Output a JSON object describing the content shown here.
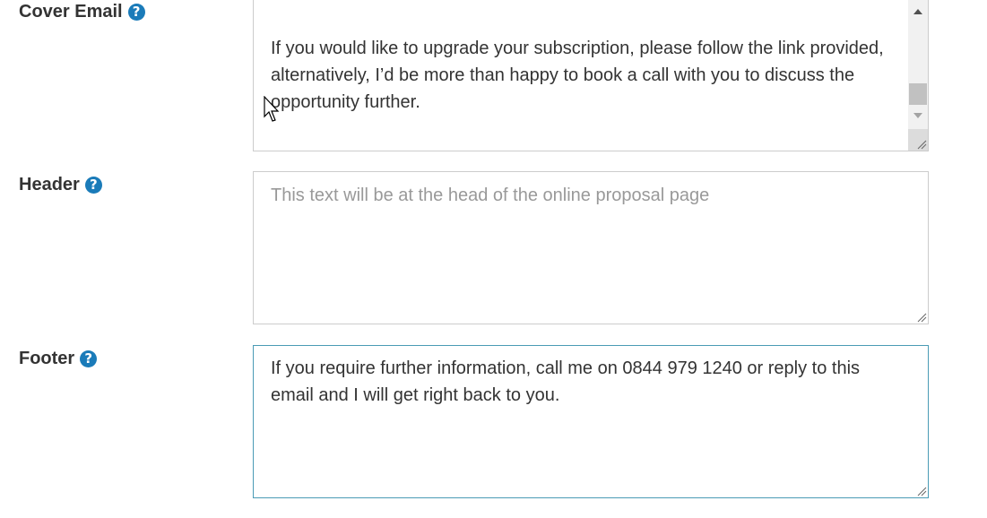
{
  "fields": {
    "cover_email": {
      "label": "Cover Email",
      "help_icon": "?",
      "paragraphs": [
        "If you would like to upgrade your subscription, please follow the link provided, alternatively, I’d be more than happy to book a call with you to discuss the opportunity further."
      ]
    },
    "header": {
      "label": "Header",
      "help_icon": "?",
      "value": "",
      "placeholder": "This text will be at the head of the online proposal page"
    },
    "footer": {
      "label": "Footer",
      "help_icon": "?",
      "value": "If you require further information, call me on 0844 979 1240 or reply to this email and I will get right back to you."
    }
  },
  "colors": {
    "help_icon": "#1a7bb9",
    "focus_border": "#4a9bb5"
  }
}
